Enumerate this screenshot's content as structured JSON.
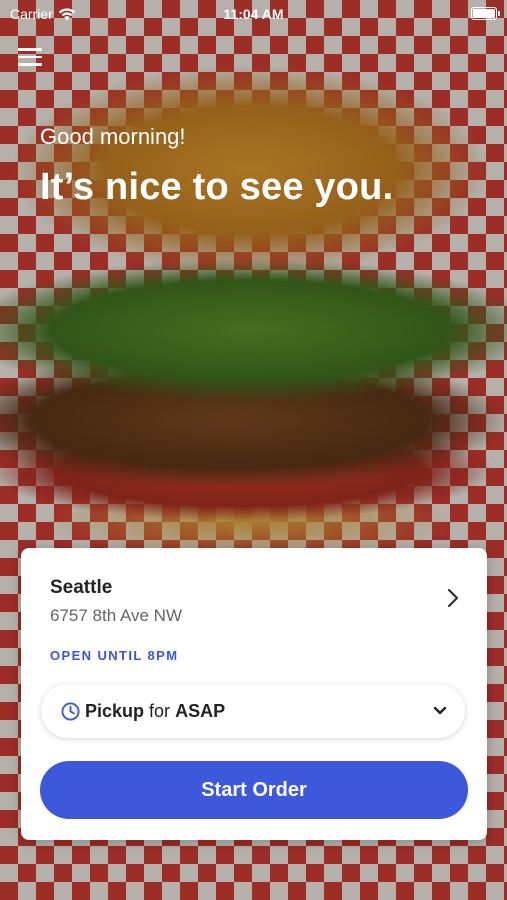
{
  "status_bar": {
    "carrier": "Carrier",
    "time": "11:04 AM"
  },
  "header": {
    "greeting": "Good morning!",
    "headline": "It’s nice to see you."
  },
  "location": {
    "city": "Seattle",
    "address": "6757 8th Ave NW",
    "hours": "OPEN UNTIL 8PM"
  },
  "pickup": {
    "mode": "Pickup",
    "connector": "for",
    "time": "ASAP"
  },
  "actions": {
    "start_order": "Start Order"
  },
  "colors": {
    "accent": "#3e58dc",
    "card_bg": "#ffffff"
  },
  "icons": {
    "menu": "hamburger-menu-icon",
    "wifi": "wifi-icon",
    "battery": "battery-icon",
    "chevron_right": "chevron-right-icon",
    "clock": "clock-icon",
    "chevron_down": "chevron-down-icon"
  }
}
